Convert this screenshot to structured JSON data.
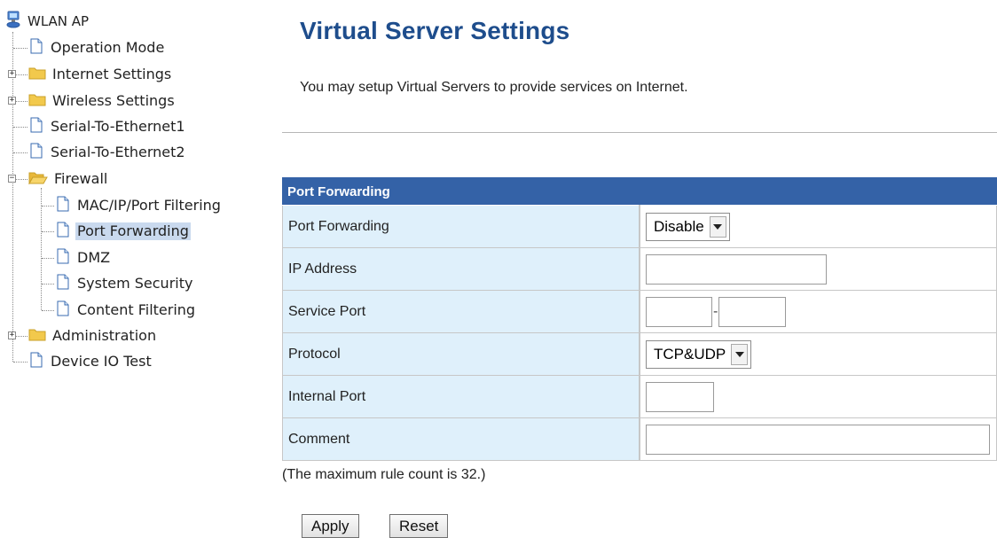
{
  "tree": {
    "root": "WLAN AP",
    "items": {
      "operation_mode": "Operation Mode",
      "internet_settings": "Internet Settings",
      "wireless_settings": "Wireless Settings",
      "serial_to_ethernet1": "Serial-To-Ethernet1",
      "serial_to_ethernet2": "Serial-To-Ethernet2",
      "firewall": "Firewall",
      "mac_ip_port_filtering": "MAC/IP/Port Filtering",
      "port_forwarding": "Port Forwarding",
      "dmz": "DMZ",
      "system_security": "System Security",
      "content_filtering": "Content Filtering",
      "administration": "Administration",
      "device_io_test": "Device IO Test"
    },
    "selected": "Port Forwarding",
    "expander_collapsed": "+",
    "expander_expanded": "−"
  },
  "page": {
    "title": "Virtual Server Settings",
    "intro": "You may setup Virtual Servers to provide services on Internet."
  },
  "form": {
    "section_title": "Port Forwarding",
    "rows": {
      "port_forwarding": {
        "label": "Port Forwarding",
        "value": "Disable"
      },
      "ip_address": {
        "label": "IP Address",
        "value": ""
      },
      "service_port": {
        "label": "Service Port",
        "from": "",
        "separator": "-",
        "to": ""
      },
      "protocol": {
        "label": "Protocol",
        "value": "TCP&UDP"
      },
      "internal_port": {
        "label": "Internal Port",
        "value": ""
      },
      "comment": {
        "label": "Comment",
        "value": ""
      }
    }
  },
  "note": "(The maximum rule count is 32.)",
  "buttons": {
    "apply": "Apply",
    "reset": "Reset"
  },
  "colors": {
    "title": "#1e4d8c",
    "section_header": "#3462a7",
    "label_cell": "#dff0fb",
    "selected_node": "#c9d9ee",
    "folder": "#f2c94c"
  },
  "icons": {
    "root": "network-computer-icon",
    "page": "page-icon",
    "folder": "folder-icon",
    "folder_open": "folder-open-icon",
    "expand": "plus-box-icon",
    "collapse": "minus-box-icon",
    "dropdown": "chevron-down-icon"
  }
}
